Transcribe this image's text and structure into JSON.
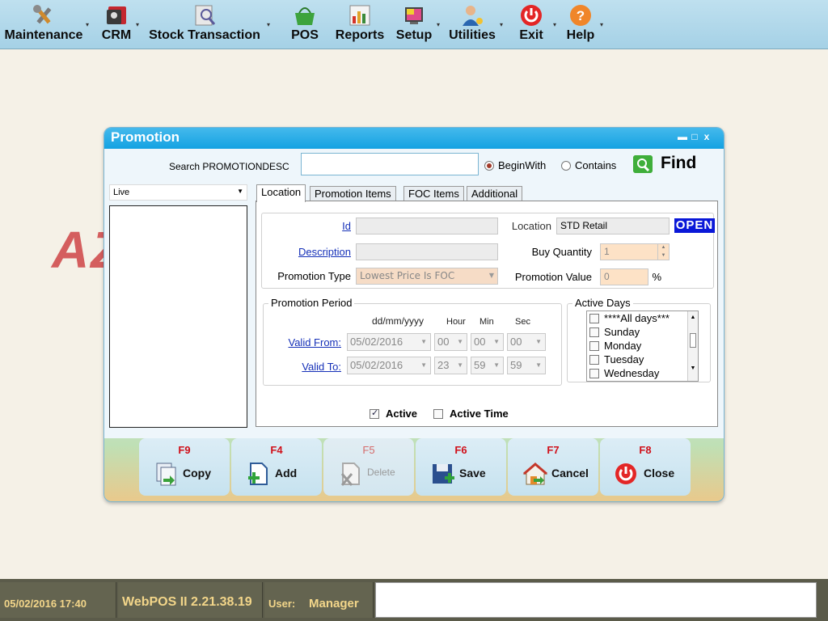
{
  "menu": {
    "items": [
      {
        "label": "Maintenance",
        "icon": "tools-icon"
      },
      {
        "label": "CRM",
        "icon": "contacts-icon"
      },
      {
        "label": "Stock Transaction",
        "icon": "stock-icon"
      },
      {
        "label": "POS",
        "icon": "basket-icon"
      },
      {
        "label": "Reports",
        "icon": "chart-icon"
      },
      {
        "label": "Setup",
        "icon": "setup-icon"
      },
      {
        "label": "Utilities",
        "icon": "user-utilities-icon"
      },
      {
        "label": "Exit",
        "icon": "power-icon"
      },
      {
        "label": "Help",
        "icon": "help-icon"
      }
    ]
  },
  "background": {
    "logo_text": "AZ"
  },
  "window": {
    "title": "Promotion",
    "controls": {
      "minimize": "▬",
      "maximize": "□",
      "close": "x"
    }
  },
  "search": {
    "label": "Search PROMOTIONDESC",
    "value": "",
    "options": [
      {
        "label": "BeginWith",
        "selected": true
      },
      {
        "label": "Contains",
        "selected": false
      }
    ],
    "find_label": "Find"
  },
  "left_panel": {
    "filter_value": "Live"
  },
  "tabs": [
    {
      "label": "Location",
      "active": true
    },
    {
      "label": "Promotion Items",
      "active": false
    },
    {
      "label": "FOC Items",
      "active": false
    },
    {
      "label": "Additional",
      "active": false
    }
  ],
  "form": {
    "id_label": "Id",
    "id_value": "",
    "location_label": "Location",
    "location_value": "STD Retail",
    "status_badge": "OPEN",
    "description_label": "Description",
    "description_value": "",
    "buy_quantity_label": "Buy Quantity",
    "buy_quantity_value": "1",
    "promotion_type_label": "Promotion Type",
    "promotion_type_value": "Lowest Price Is FOC",
    "promotion_value_label": "Promotion Value",
    "promotion_value_value": "0",
    "percent_symbol": "%"
  },
  "period": {
    "title": "Promotion Period",
    "date_header": "dd/mm/yyyy",
    "hour_header": "Hour",
    "min_header": "Min",
    "sec_header": "Sec",
    "valid_from_label": "Valid From:",
    "valid_from": {
      "date": "05/02/2016",
      "hour": "00",
      "min": "00",
      "sec": "00"
    },
    "valid_to_label": "Valid To:",
    "valid_to": {
      "date": "05/02/2016",
      "hour": "23",
      "min": "59",
      "sec": "59"
    }
  },
  "active_days": {
    "title": "Active Days",
    "items": [
      "****All days***",
      "Sunday",
      "Monday",
      "Tuesday",
      "Wednesday"
    ]
  },
  "flags": {
    "active_label": "Active",
    "active_checked": true,
    "active_time_label": "Active Time",
    "active_time_checked": false
  },
  "actions": [
    {
      "key": "F9",
      "label": "Copy",
      "icon": "copy-icon",
      "enabled": true
    },
    {
      "key": "F4",
      "label": "Add",
      "icon": "add-icon",
      "enabled": true
    },
    {
      "key": "F5",
      "label": "Delete",
      "icon": "delete-icon",
      "enabled": false
    },
    {
      "key": "F6",
      "label": "Save",
      "icon": "save-icon",
      "enabled": true
    },
    {
      "key": "F7",
      "label": "Cancel",
      "icon": "cancel-icon",
      "enabled": true
    },
    {
      "key": "F8",
      "label": "Close",
      "icon": "close-power-icon",
      "enabled": true
    }
  ],
  "status": {
    "datetime": "05/02/2016 17:40",
    "version": "WebPOS II 2.21.38.19",
    "user_label": "User:",
    "user_value": "Manager"
  }
}
